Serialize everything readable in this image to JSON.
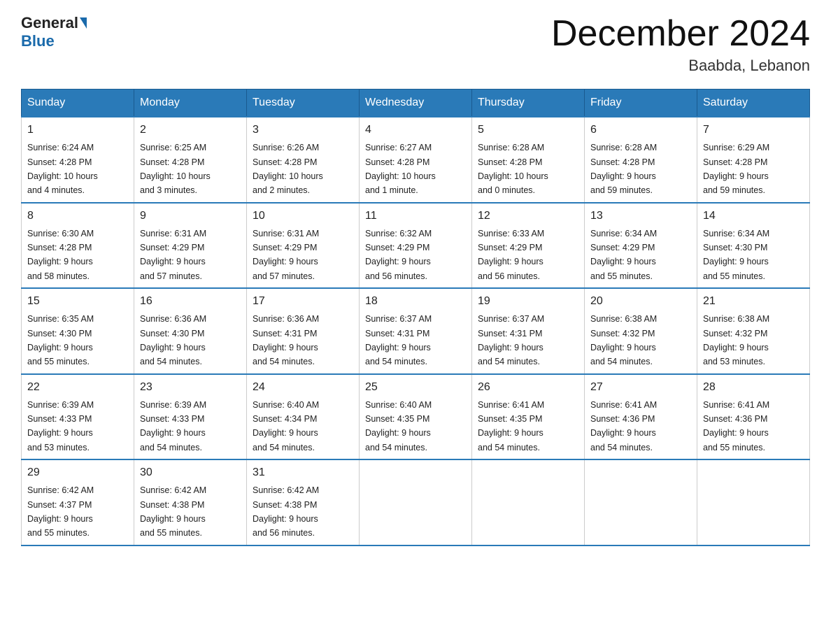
{
  "header": {
    "logo_general": "General",
    "logo_blue": "Blue",
    "month_title": "December 2024",
    "location": "Baabda, Lebanon"
  },
  "weekdays": [
    "Sunday",
    "Monday",
    "Tuesday",
    "Wednesday",
    "Thursday",
    "Friday",
    "Saturday"
  ],
  "weeks": [
    [
      {
        "day": "1",
        "sunrise": "6:24 AM",
        "sunset": "4:28 PM",
        "daylight": "10 hours and 4 minutes."
      },
      {
        "day": "2",
        "sunrise": "6:25 AM",
        "sunset": "4:28 PM",
        "daylight": "10 hours and 3 minutes."
      },
      {
        "day": "3",
        "sunrise": "6:26 AM",
        "sunset": "4:28 PM",
        "daylight": "10 hours and 2 minutes."
      },
      {
        "day": "4",
        "sunrise": "6:27 AM",
        "sunset": "4:28 PM",
        "daylight": "10 hours and 1 minute."
      },
      {
        "day": "5",
        "sunrise": "6:28 AM",
        "sunset": "4:28 PM",
        "daylight": "10 hours and 0 minutes."
      },
      {
        "day": "6",
        "sunrise": "6:28 AM",
        "sunset": "4:28 PM",
        "daylight": "9 hours and 59 minutes."
      },
      {
        "day": "7",
        "sunrise": "6:29 AM",
        "sunset": "4:28 PM",
        "daylight": "9 hours and 59 minutes."
      }
    ],
    [
      {
        "day": "8",
        "sunrise": "6:30 AM",
        "sunset": "4:28 PM",
        "daylight": "9 hours and 58 minutes."
      },
      {
        "day": "9",
        "sunrise": "6:31 AM",
        "sunset": "4:29 PM",
        "daylight": "9 hours and 57 minutes."
      },
      {
        "day": "10",
        "sunrise": "6:31 AM",
        "sunset": "4:29 PM",
        "daylight": "9 hours and 57 minutes."
      },
      {
        "day": "11",
        "sunrise": "6:32 AM",
        "sunset": "4:29 PM",
        "daylight": "9 hours and 56 minutes."
      },
      {
        "day": "12",
        "sunrise": "6:33 AM",
        "sunset": "4:29 PM",
        "daylight": "9 hours and 56 minutes."
      },
      {
        "day": "13",
        "sunrise": "6:34 AM",
        "sunset": "4:29 PM",
        "daylight": "9 hours and 55 minutes."
      },
      {
        "day": "14",
        "sunrise": "6:34 AM",
        "sunset": "4:30 PM",
        "daylight": "9 hours and 55 minutes."
      }
    ],
    [
      {
        "day": "15",
        "sunrise": "6:35 AM",
        "sunset": "4:30 PM",
        "daylight": "9 hours and 55 minutes."
      },
      {
        "day": "16",
        "sunrise": "6:36 AM",
        "sunset": "4:30 PM",
        "daylight": "9 hours and 54 minutes."
      },
      {
        "day": "17",
        "sunrise": "6:36 AM",
        "sunset": "4:31 PM",
        "daylight": "9 hours and 54 minutes."
      },
      {
        "day": "18",
        "sunrise": "6:37 AM",
        "sunset": "4:31 PM",
        "daylight": "9 hours and 54 minutes."
      },
      {
        "day": "19",
        "sunrise": "6:37 AM",
        "sunset": "4:31 PM",
        "daylight": "9 hours and 54 minutes."
      },
      {
        "day": "20",
        "sunrise": "6:38 AM",
        "sunset": "4:32 PM",
        "daylight": "9 hours and 54 minutes."
      },
      {
        "day": "21",
        "sunrise": "6:38 AM",
        "sunset": "4:32 PM",
        "daylight": "9 hours and 53 minutes."
      }
    ],
    [
      {
        "day": "22",
        "sunrise": "6:39 AM",
        "sunset": "4:33 PM",
        "daylight": "9 hours and 53 minutes."
      },
      {
        "day": "23",
        "sunrise": "6:39 AM",
        "sunset": "4:33 PM",
        "daylight": "9 hours and 54 minutes."
      },
      {
        "day": "24",
        "sunrise": "6:40 AM",
        "sunset": "4:34 PM",
        "daylight": "9 hours and 54 minutes."
      },
      {
        "day": "25",
        "sunrise": "6:40 AM",
        "sunset": "4:35 PM",
        "daylight": "9 hours and 54 minutes."
      },
      {
        "day": "26",
        "sunrise": "6:41 AM",
        "sunset": "4:35 PM",
        "daylight": "9 hours and 54 minutes."
      },
      {
        "day": "27",
        "sunrise": "6:41 AM",
        "sunset": "4:36 PM",
        "daylight": "9 hours and 54 minutes."
      },
      {
        "day": "28",
        "sunrise": "6:41 AM",
        "sunset": "4:36 PM",
        "daylight": "9 hours and 55 minutes."
      }
    ],
    [
      {
        "day": "29",
        "sunrise": "6:42 AM",
        "sunset": "4:37 PM",
        "daylight": "9 hours and 55 minutes."
      },
      {
        "day": "30",
        "sunrise": "6:42 AM",
        "sunset": "4:38 PM",
        "daylight": "9 hours and 55 minutes."
      },
      {
        "day": "31",
        "sunrise": "6:42 AM",
        "sunset": "4:38 PM",
        "daylight": "9 hours and 56 minutes."
      },
      null,
      null,
      null,
      null
    ]
  ],
  "labels": {
    "sunrise": "Sunrise:",
    "sunset": "Sunset:",
    "daylight": "Daylight:"
  }
}
